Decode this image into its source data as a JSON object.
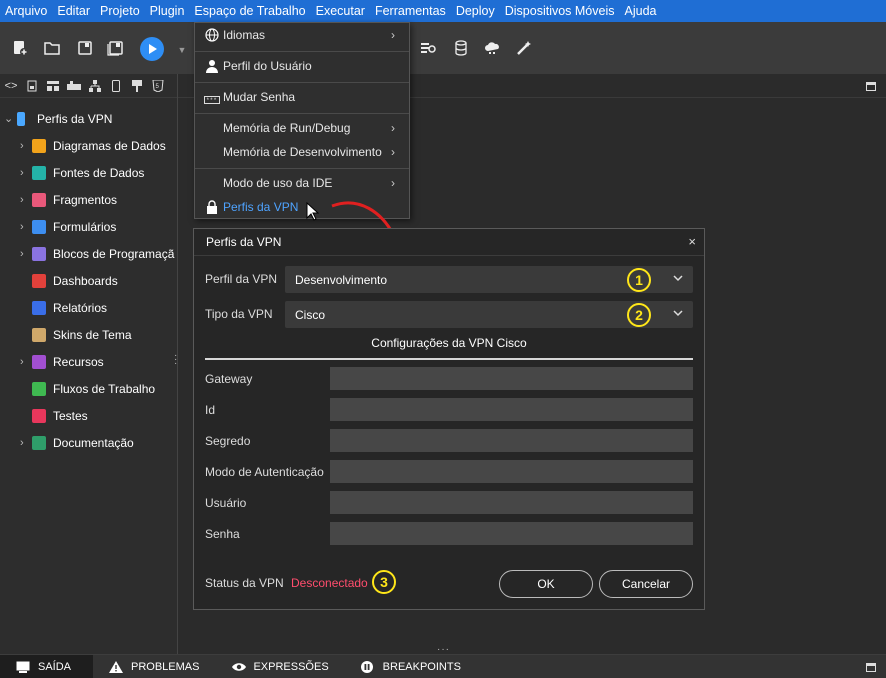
{
  "menubar": {
    "items": [
      "Arquivo",
      "Editar",
      "Projeto",
      "Plugin",
      "Espaço de Trabalho",
      "Executar",
      "Ferramentas",
      "Deploy",
      "Dispositivos Móveis",
      "Ajuda"
    ]
  },
  "toolbar": {
    "icons": [
      "new-file-icon",
      "open-folder-icon",
      "save-icon",
      "save-all-icon",
      "run-icon",
      "console-search-icon",
      "database-icon",
      "cloud-icon",
      "magic-wand-icon"
    ]
  },
  "sidebar": {
    "top_icons": [
      "code-icon",
      "page-icon",
      "layout-icon",
      "component-icon",
      "tree-icon",
      "mobile-icon",
      "style-icon",
      "html5-icon"
    ],
    "root_label": "Perfis da VPN",
    "items": [
      {
        "label": "Diagramas de Dados",
        "icon": "diagram-icon",
        "color": "#f2a31b",
        "expandable": true
      },
      {
        "label": "Fontes de Dados",
        "icon": "datasource-icon",
        "color": "#24b3a8",
        "expandable": true
      },
      {
        "label": "Fragmentos",
        "icon": "fragment-icon",
        "color": "#e9587a",
        "expandable": true
      },
      {
        "label": "Formulários",
        "icon": "form-icon",
        "color": "#3d8ef0",
        "expandable": true
      },
      {
        "label": "Blocos de Programaçã",
        "icon": "blocks-icon",
        "color": "#8a73e0",
        "expandable": true
      },
      {
        "label": "Dashboards",
        "icon": "dashboard-icon",
        "color": "#e2413b",
        "expandable": false
      },
      {
        "label": "Relatórios",
        "icon": "report-icon",
        "color": "#3a6ee8",
        "expandable": false
      },
      {
        "label": "Skins de Tema",
        "icon": "palette-icon",
        "color": "#cfa86a",
        "expandable": false
      },
      {
        "label": "Recursos",
        "icon": "resources-icon",
        "color": "#a24fd1",
        "expandable": true
      },
      {
        "label": "Fluxos de Trabalho",
        "icon": "workflow-icon",
        "color": "#3fb951",
        "expandable": false
      },
      {
        "label": "Testes",
        "icon": "test-icon",
        "color": "#e8375c",
        "expandable": false
      },
      {
        "label": "Documentação",
        "icon": "docs-icon",
        "color": "#2f9e6a",
        "expandable": true
      }
    ]
  },
  "dropdown": {
    "items": [
      {
        "label": "Idiomas",
        "icon": "globe-icon",
        "submenu": true
      },
      {
        "label": "Perfil do Usuário",
        "icon": "user-icon",
        "submenu": false
      },
      {
        "label": "Mudar Senha",
        "icon": "password-icon",
        "submenu": false
      },
      {
        "label": "Memória de Run/Debug",
        "icon": "",
        "submenu": true
      },
      {
        "label": "Memória de Desenvolvimento",
        "icon": "",
        "submenu": true
      },
      {
        "label": "Modo de uso da IDE",
        "icon": "",
        "submenu": true
      },
      {
        "label": "Perfis da VPN",
        "icon": "lock-icon",
        "submenu": false
      }
    ]
  },
  "dialog": {
    "title": "Perfis da VPN",
    "close": "×",
    "profile_label": "Perfil da VPN",
    "profile_value": "Desenvolvimento",
    "type_label": "Tipo da VPN",
    "type_value": "Cisco",
    "section_title": "Configurações da VPN Cisco",
    "fields": [
      {
        "label": "Gateway",
        "value": ""
      },
      {
        "label": "Id",
        "value": ""
      },
      {
        "label": "Segredo",
        "value": ""
      },
      {
        "label": "Modo de Autenticação",
        "value": ""
      },
      {
        "label": "Usuário",
        "value": ""
      },
      {
        "label": "Senha",
        "value": ""
      }
    ],
    "status_label": "Status da VPN",
    "status_value": "Desconectado",
    "ok_label": "OK",
    "cancel_label": "Cancelar",
    "badges": [
      "1",
      "2",
      "3"
    ]
  },
  "bottombar": {
    "tabs": [
      {
        "label": "SAÍDA",
        "icon": "monitor-icon"
      },
      {
        "label": "PROBLEMAS",
        "icon": "warning-icon"
      },
      {
        "label": "EXPRESSÕES",
        "icon": "eye-icon"
      },
      {
        "label": "BREAKPOINTS",
        "icon": "pause-icon"
      }
    ]
  },
  "colors": {
    "menubar": "#1f6ed4",
    "accent": "#2e8ef5",
    "badge": "#ffe619",
    "status_disconnected": "#ff4d6d",
    "arrow": "#e02020"
  }
}
